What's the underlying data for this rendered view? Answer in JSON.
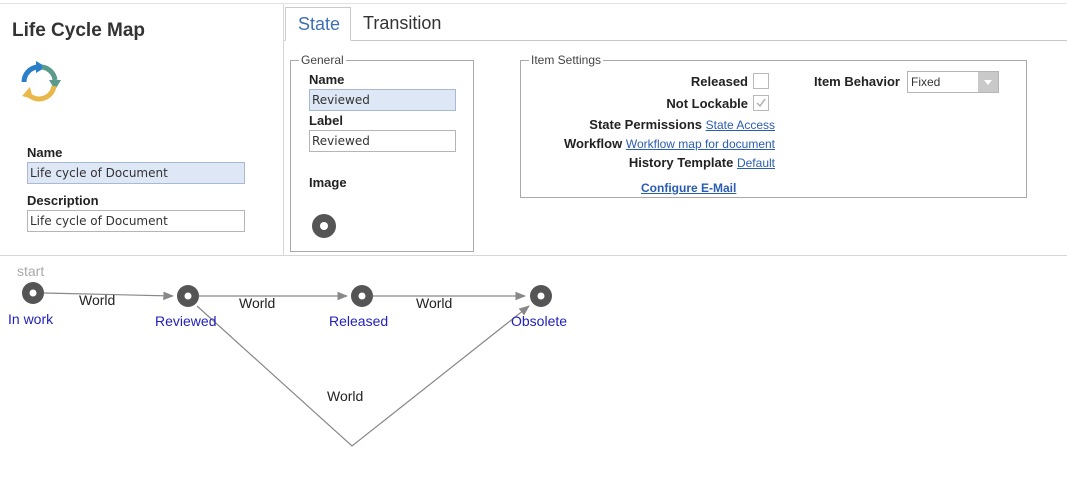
{
  "left": {
    "app_title": "Life Cycle Map",
    "name_label": "Name",
    "name_value": "Life cycle of Document",
    "description_label": "Description",
    "description_value": "Life cycle of Document"
  },
  "tabs": [
    {
      "label": "State",
      "active": true
    },
    {
      "label": "Transition",
      "active": false
    }
  ],
  "general": {
    "legend": "General",
    "name_label": "Name",
    "name_value": "Reviewed",
    "label_label": "Label",
    "label_value": "Reviewed",
    "image_label": "Image"
  },
  "item_settings": {
    "legend": "Item Settings",
    "released_label": "Released",
    "released_checked": false,
    "not_lockable_label": "Not Lockable",
    "not_lockable_checked": true,
    "state_permissions_label": "State Permissions",
    "state_permissions_link": "State Access",
    "workflow_label": "Workflow",
    "workflow_link": "Workflow map for document",
    "history_template_label": "History Template",
    "history_template_link": "Default",
    "configure_email_link": "Configure E-Mail",
    "item_behavior_label": "Item Behavior",
    "item_behavior_value": "Fixed"
  },
  "diagram": {
    "start_label": "start",
    "nodes": [
      {
        "id": "in-work",
        "label": "In work"
      },
      {
        "id": "reviewed",
        "label": "Reviewed"
      },
      {
        "id": "released",
        "label": "Released"
      },
      {
        "id": "obsolete",
        "label": "Obsolete"
      }
    ],
    "edges": [
      {
        "from": "in-work",
        "to": "reviewed",
        "label": "World"
      },
      {
        "from": "reviewed",
        "to": "released",
        "label": "World"
      },
      {
        "from": "released",
        "to": "obsolete",
        "label": "World"
      },
      {
        "from": "reviewed",
        "to": "obsolete",
        "label": "World"
      }
    ],
    "colors": {
      "node": "#555555",
      "node_label": "#2222bb",
      "edge": "#888888"
    }
  }
}
